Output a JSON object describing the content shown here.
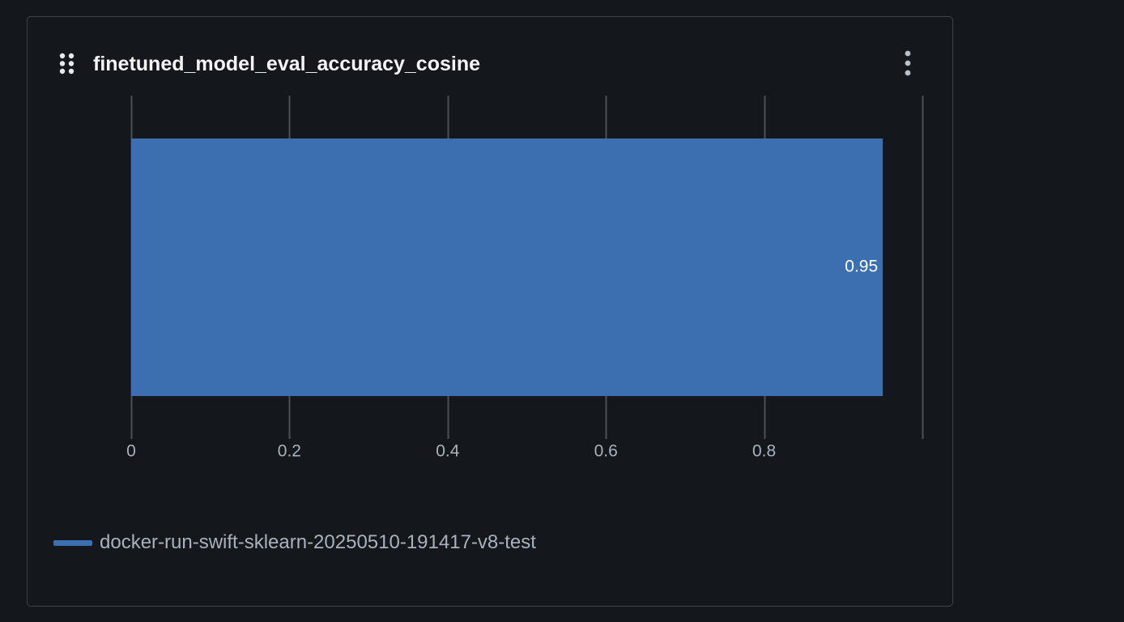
{
  "panel": {
    "title": "finetuned_model_eval_accuracy_cosine",
    "drag_icon": "drag-handle-icon",
    "menu_icon": "kebab-menu-icon"
  },
  "chart_data": {
    "type": "bar",
    "orientation": "horizontal",
    "categories": [
      "docker-run-swift-sklearn-20250510-191417-v8-test"
    ],
    "series": [
      {
        "name": "docker-run-swift-sklearn-20250510-191417-v8-test",
        "values": [
          0.95
        ],
        "color": "#3b6fb0"
      }
    ],
    "data_labels": [
      "0.95"
    ],
    "xlim": [
      0,
      1
    ],
    "xticks": [
      0,
      0.2,
      0.4,
      0.6,
      0.8,
      1
    ],
    "xtick_labels": [
      "0",
      "0.2",
      "0.4",
      "0.6",
      "0.8",
      ""
    ],
    "grid": true,
    "legend_position": "bottom-left"
  },
  "colors": {
    "background": "#14181c",
    "gridline": "#4a4f55",
    "tick_label": "#a9b1ba",
    "bar": "#3b6fb0",
    "data_label": "#ffffff"
  }
}
